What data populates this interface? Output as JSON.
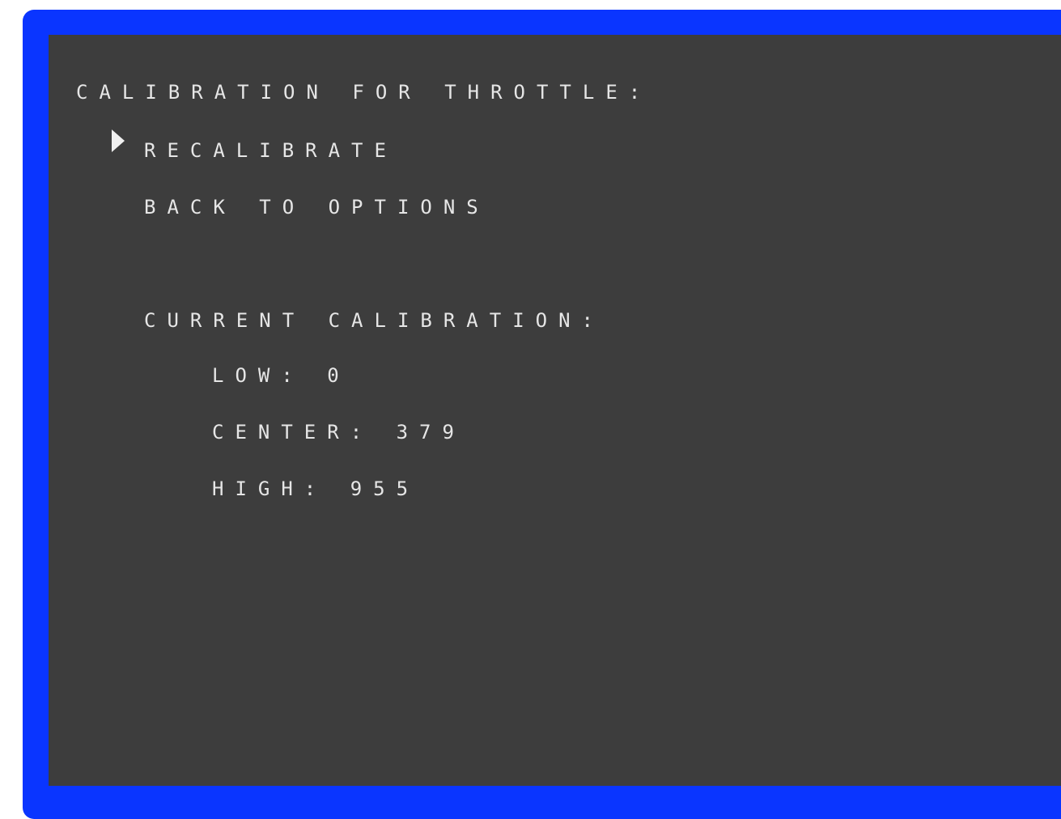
{
  "menu": {
    "title": "Calibration for Throttle:",
    "items": [
      {
        "label": "Recalibrate",
        "selected": true
      },
      {
        "label": "Back to Options",
        "selected": false
      }
    ],
    "selector_icon": "triangle-pointer-icon"
  },
  "calibration": {
    "heading": "Current Calibration:",
    "low_label": "Low:",
    "low_value": "0",
    "center_label": "Center:",
    "center_value": "379",
    "high_label": "High:",
    "high_value": "955"
  },
  "colors": {
    "bezel": "#0a35ff",
    "screen": "#3d3d3d",
    "text": "#e6e6e6"
  }
}
